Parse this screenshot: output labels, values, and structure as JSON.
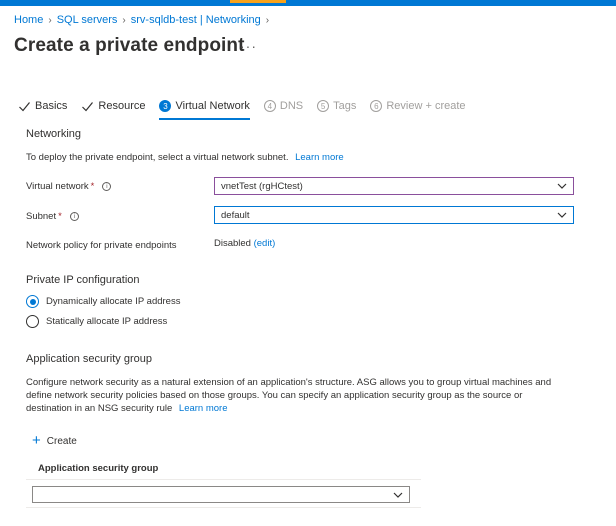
{
  "breadcrumb": {
    "items": [
      "Home",
      "SQL servers",
      "srv-sqldb-test | Networking"
    ]
  },
  "page": {
    "title": "Create a private endpoint",
    "more": "···"
  },
  "tabs": [
    {
      "label": "Basics",
      "marker": "check",
      "state": "done"
    },
    {
      "label": "Resource",
      "marker": "check",
      "state": "done"
    },
    {
      "label": "Virtual Network",
      "marker": "3",
      "state": "active"
    },
    {
      "label": "DNS",
      "marker": "4",
      "state": "disabled"
    },
    {
      "label": "Tags",
      "marker": "5",
      "state": "disabled"
    },
    {
      "label": "Review + create",
      "marker": "6",
      "state": "disabled"
    }
  ],
  "networking": {
    "title": "Networking",
    "description": "To deploy the private endpoint, select a virtual network subnet.",
    "learn_more": "Learn more",
    "virtual_network": {
      "label": "Virtual network",
      "required": "*",
      "value": "vnetTest (rgHCtest)"
    },
    "subnet": {
      "label": "Subnet",
      "required": "*",
      "value": "default"
    },
    "network_policy": {
      "label": "Network policy for private endpoints",
      "value": "Disabled",
      "edit": "(edit)"
    }
  },
  "private_ip": {
    "title": "Private IP configuration",
    "options": [
      {
        "label": "Dynamically allocate IP address",
        "checked": true
      },
      {
        "label": "Statically allocate IP address",
        "checked": false
      }
    ]
  },
  "asg": {
    "title": "Application security group",
    "description_line1": "Configure network security as a natural extension of an application's structure. ASG allows you to group virtual machines and",
    "description_line2": "define network security policies based on those groups. You can specify an application security group as the source or",
    "description_line3": "destination in an NSG security rule",
    "learn_more": "Learn more",
    "create_label": "Create",
    "column_header": "Application security group",
    "select_value": ""
  },
  "colors": {
    "accent": "#0078d4",
    "required": "#a4262c",
    "topbar_highlight": "#f7a21b"
  }
}
